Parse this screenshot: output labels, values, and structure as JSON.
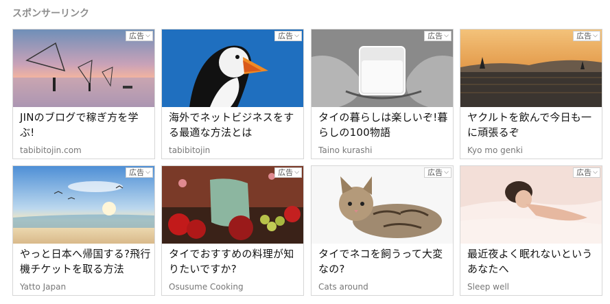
{
  "header": {
    "title": "スポンサーリンク"
  },
  "ad_label": "広告",
  "cards": [
    {
      "title": "JINのブログで稼ぎ方を学ぶ!",
      "source": "tabibitojin.com",
      "image": "fishermen-sunset"
    },
    {
      "title": "海外でネットビジネスをする最適な方法とは",
      "source": "tabibitojin",
      "image": "puffin"
    },
    {
      "title": "タイの暮らしは楽しいぞ!暮らしの100物語",
      "source": "Taino kurashi",
      "image": "hands-milk-glass"
    },
    {
      "title": "ヤクルトを飲んで今日も一に頑張るぞ",
      "source": "Kyo mo genki",
      "image": "sea-sailboats"
    },
    {
      "title": "やっと日本へ帰国する?飛行機チケットを取る方法",
      "source": "Yatto Japan",
      "image": "beach-birds"
    },
    {
      "title": "タイでおすすめの料理が知りたいですか?",
      "source": "Osusume Cooking",
      "image": "fruit-still-life"
    },
    {
      "title": "タイでネコを飼うって大変なの?",
      "source": "Cats around",
      "image": "tabby-cat"
    },
    {
      "title": "最近夜よく眠れないというあなたへ",
      "source": "Sleep well",
      "image": "sleeping-woman"
    }
  ]
}
